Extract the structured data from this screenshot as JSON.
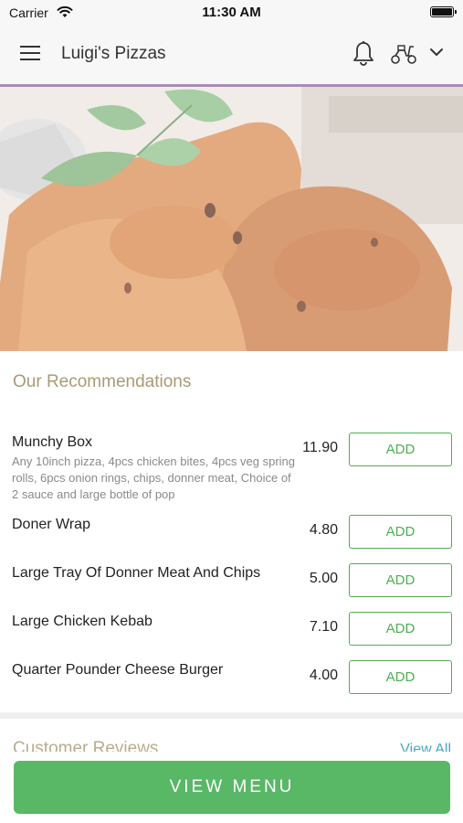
{
  "status_bar": {
    "carrier": "Carrier",
    "time": "11:30 AM"
  },
  "header": {
    "title": "Luigi's Pizzas",
    "icons": [
      "menu-icon",
      "bell-icon",
      "scooter-icon",
      "chevron-down-icon"
    ]
  },
  "recommendations": {
    "title": "Our Recommendations",
    "items": [
      {
        "name": "Munchy Box",
        "description": "Any 10inch pizza, 4pcs chicken bites, 4pcs veg spring rolls, 6pcs onion rings, chips, donner meat, Choice of 2 sauce and large bottle of pop",
        "price": "11.90",
        "add_label": "ADD"
      },
      {
        "name": "Doner Wrap",
        "price": "4.80",
        "add_label": "ADD"
      },
      {
        "name": "Large Tray Of Donner Meat And Chips",
        "price": "5.00",
        "add_label": "ADD"
      },
      {
        "name": "Large Chicken Kebab",
        "price": "7.10",
        "add_label": "ADD"
      },
      {
        "name": "Quarter Pounder Cheese Burger",
        "price": "4.00",
        "add_label": "ADD"
      }
    ]
  },
  "reviews": {
    "title": "Customer Reviews",
    "view_all": "View All"
  },
  "footer": {
    "view_menu_label": "VIEW MENU"
  },
  "colors": {
    "accent_green": "#58b866",
    "section_title": "#a99b74",
    "header_line": "#a98bb8",
    "link_blue": "#4aa6c8"
  }
}
